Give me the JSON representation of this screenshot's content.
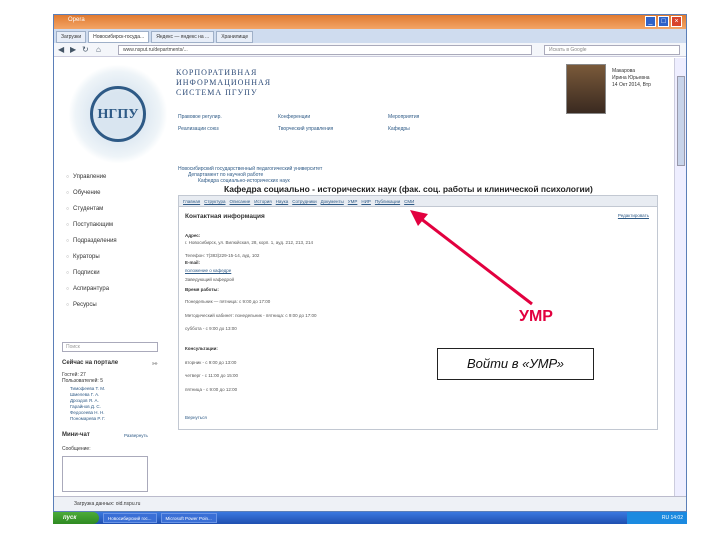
{
  "browser": {
    "title": "Opera",
    "tabs": [
      "Загрузки",
      "Новосибирск-госуда...",
      "Яндекс — яндекс на ...",
      "Хранилище"
    ],
    "address": "www.nsput.ru/departments/...",
    "search_placeholder": "Искать в Google"
  },
  "site": {
    "title_lines": [
      "КОРПОРАТИВНАЯ",
      "ИНФОРМАЦИОННАЯ",
      "СИСТЕМА ПГУПУ"
    ],
    "user": {
      "name_lines": [
        "Макарова",
        "Ирина Юрьевна",
        "14 Окт 2014, Втр"
      ]
    },
    "top_menu": [
      [
        "Правовое регулир.",
        "Конференции",
        "Мероприятия"
      ],
      [
        "Реализации союз",
        "Творческий управления",
        "Кафедры"
      ]
    ]
  },
  "sidebar": {
    "items": [
      "Управление",
      "Обучение",
      "Студентам",
      "Поступающим",
      "Подразделения",
      "Кураторы",
      "Подписки",
      "Аспирантура",
      "Ресурсы"
    ],
    "search_placeholder": "Поиск",
    "online_title": "Сейчас на портале",
    "online_more": "»»",
    "online_count": "Гостей: 27",
    "users_label": "Пользователей: 5",
    "online_users": [
      "Тимофеева Т. М.",
      "Шмелева Г. А.",
      "Дроздов Я. А.",
      "Гарайнов Д. С.",
      "Федосеева Н. Н.",
      "Пономарева Р. Г."
    ],
    "chat_title": "Мини-чат",
    "chat_link": "Развернуть",
    "chat_label": "Сообщение:"
  },
  "breadcrumbs": [
    "Новосибирский государственный педагогический университет",
    "Департамент по научной работе",
    "Кафедра социально-исторических наук"
  ],
  "department_title": "Кафедра социально - исторических наук (фак. соц. работы и клинической психологии)",
  "dept_nav": [
    "Главная",
    "Структура",
    "Описание",
    "История",
    "Наука",
    "Сотрудники",
    "Документы",
    "УМР",
    "НИР",
    "Публикации",
    "СМИ"
  ],
  "main": {
    "title": "Контактная информация",
    "edit": "Редактировать",
    "address_label": "Адрес:",
    "address": "г. Новосибирск, ул. Вилюйская, 28, корп. 1, ауд. 212, 213, 214",
    "phone": "Телефон: 7(383)229-15-14, ауд. 102",
    "email_label": "E-mail:",
    "document": "положение о кафедре",
    "person": "Заведующий кафедрой",
    "time_label": "Время работы:",
    "hours": [
      "Понедельник — пятница: с 9:00 до 17:00",
      "Методический кабинет: понедельник - пятница: с 9:00 до 17:00"
    ],
    "sub": "суббота - с 9:00 до 13:00",
    "weekend_label": "Консультации:",
    "weekend": [
      "вторник - с 9:00 до 13:00",
      "четверг - с 11:00 до 15:00",
      "пятница - с 9:00 до 12:00"
    ],
    "footer": "Вернуться"
  },
  "annotation": {
    "label": "УМР",
    "callout": "Войти в «УМР»",
    "color": "#e2003f"
  },
  "statusbar": "Загрузка данных: oid.nspu.ru",
  "taskbar": {
    "start": "пуск",
    "tasks": [
      "Новосибирский гос...",
      "Microsoft Power Poin..."
    ],
    "clock": "RU 14:02"
  }
}
